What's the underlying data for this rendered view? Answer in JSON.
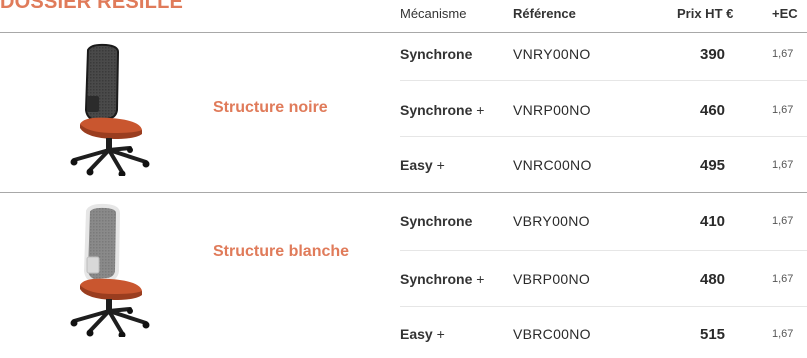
{
  "section_title": "DOSSIER RÉSILLE",
  "headers": {
    "mecanisme": "Mécanisme",
    "reference": "Référence",
    "prix": "Prix HT €",
    "ec": "+EC"
  },
  "groups": [
    {
      "label": "Structure noire",
      "chair_color": "#222222",
      "rows": [
        {
          "meca": "Synchrone",
          "suffix": "",
          "ref": "VNRY00NO",
          "prix": "390",
          "ec": "1,67"
        },
        {
          "meca": "Synchrone",
          "suffix": " +",
          "ref": "VNRP00NO",
          "prix": "460",
          "ec": "1,67"
        },
        {
          "meca": "Easy",
          "suffix": " +",
          "ref": "VNRC00NO",
          "prix": "495",
          "ec": "1,67"
        }
      ]
    },
    {
      "label": "Structure blanche",
      "chair_color": "#e6e6e6",
      "rows": [
        {
          "meca": "Synchrone",
          "suffix": "",
          "ref": "VBRY00NO",
          "prix": "410",
          "ec": "1,67"
        },
        {
          "meca": "Synchrone",
          "suffix": " +",
          "ref": "VBRP00NO",
          "prix": "480",
          "ec": "1,67"
        },
        {
          "meca": "Easy",
          "suffix": " +",
          "ref": "VBRC00NO",
          "prix": "515",
          "ec": "1,67"
        }
      ]
    }
  ],
  "colors": {
    "accent": "#e07b5a",
    "seat": "#c9562f"
  }
}
